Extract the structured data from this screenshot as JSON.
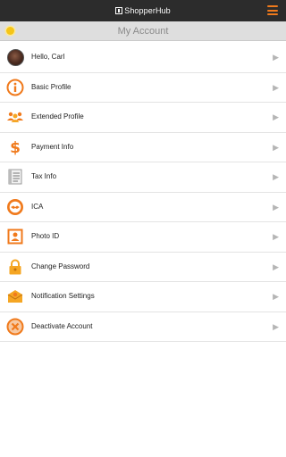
{
  "header": {
    "brand": "ShopperHub",
    "menu_icon": "hamburger-menu-icon"
  },
  "subheader": {
    "title": "My Account",
    "left_icon": "lightbulb-icon"
  },
  "colors": {
    "accent": "#f07a1c",
    "topbar": "#2c2c2c",
    "subbar": "#dedede"
  },
  "menu": {
    "items": [
      {
        "label": "Hello, Carl",
        "icon": "avatar"
      },
      {
        "label": "Basic Profile",
        "icon": "info-icon"
      },
      {
        "label": "Extended Profile",
        "icon": "people-icon"
      },
      {
        "label": "Payment Info",
        "icon": "dollar-icon"
      },
      {
        "label": "Tax Info",
        "icon": "document-icon"
      },
      {
        "label": "ICA",
        "icon": "handshake-icon"
      },
      {
        "label": "Photo ID",
        "icon": "id-card-icon"
      },
      {
        "label": "Change Password",
        "icon": "lock-icon"
      },
      {
        "label": "Notification Settings",
        "icon": "envelope-icon"
      },
      {
        "label": "Deactivate Account",
        "icon": "cancel-icon"
      }
    ]
  }
}
